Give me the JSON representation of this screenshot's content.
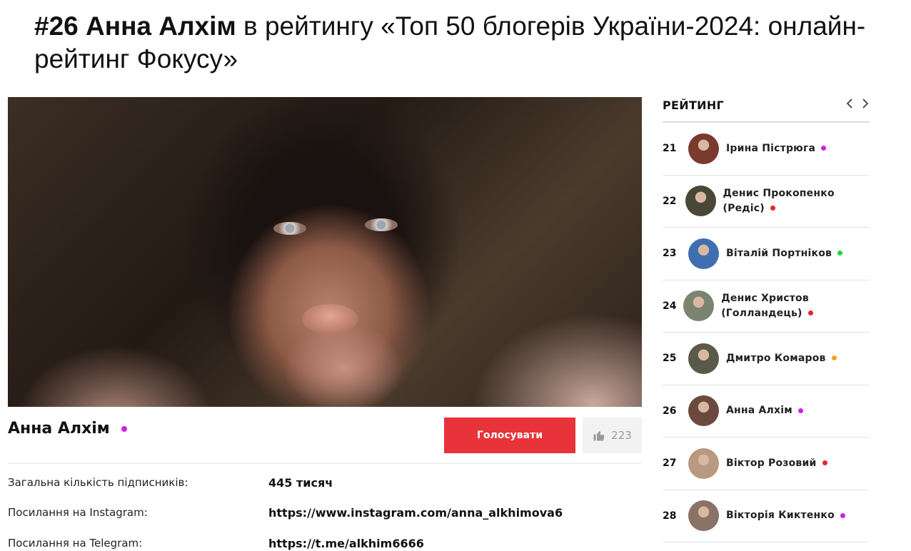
{
  "page": {
    "title_bold": "#26 Анна Алхім",
    "title_rest": "в рейтингу «Топ 50 блогерів України-2024: онлайн-рейтинг Фокусу»"
  },
  "profile": {
    "name": "Анна Алхім",
    "dot_color": "#d020e8",
    "vote_label": "Голосувати",
    "likes": "223",
    "like_icon": "thumbs-up-icon",
    "hero_image": "portrait-photo"
  },
  "info": [
    {
      "label": "Загальна кількість підписників:",
      "value": "445 тисяч"
    },
    {
      "label": "Посилання на Instagram:",
      "value": "https://www.instagram.com/anna_alkhimova6"
    },
    {
      "label": "Посилання на Telegram:",
      "value": "https://t.me/alkhim6666"
    }
  ],
  "sidebar": {
    "title": "РЕЙТИНГ",
    "prev_icon": "chevron-left-icon",
    "next_icon": "chevron-right-icon",
    "items": [
      {
        "rank": "21",
        "name": "Ірина Пістрюга",
        "dot": "#d020e8",
        "avatar": "#7a3a2e"
      },
      {
        "rank": "22",
        "name": "Денис Прокопенко (Редіс)",
        "dot": "#e8242b",
        "avatar": "#4a4638"
      },
      {
        "rank": "23",
        "name": "Віталій Портніков",
        "dot": "#22d83a",
        "avatar": "#3f6fb0"
      },
      {
        "rank": "24",
        "name": "Денис Христов (Голландець)",
        "dot": "#e8242b",
        "avatar": "#7b8470"
      },
      {
        "rank": "25",
        "name": "Дмитро Комаров",
        "dot": "#f0a51c",
        "avatar": "#5a5a4a"
      },
      {
        "rank": "26",
        "name": "Анна Алхім",
        "dot": "#d020e8",
        "avatar": "#6b4a3e"
      },
      {
        "rank": "27",
        "name": "Віктор Розовий",
        "dot": "#e8242b",
        "avatar": "#b89a82"
      },
      {
        "rank": "28",
        "name": "Вікторія Киктенко",
        "dot": "#d020e8",
        "avatar": "#8a7266"
      }
    ]
  },
  "colors": {
    "accent": "#e8333b",
    "like_bg": "#f2f2f2"
  }
}
